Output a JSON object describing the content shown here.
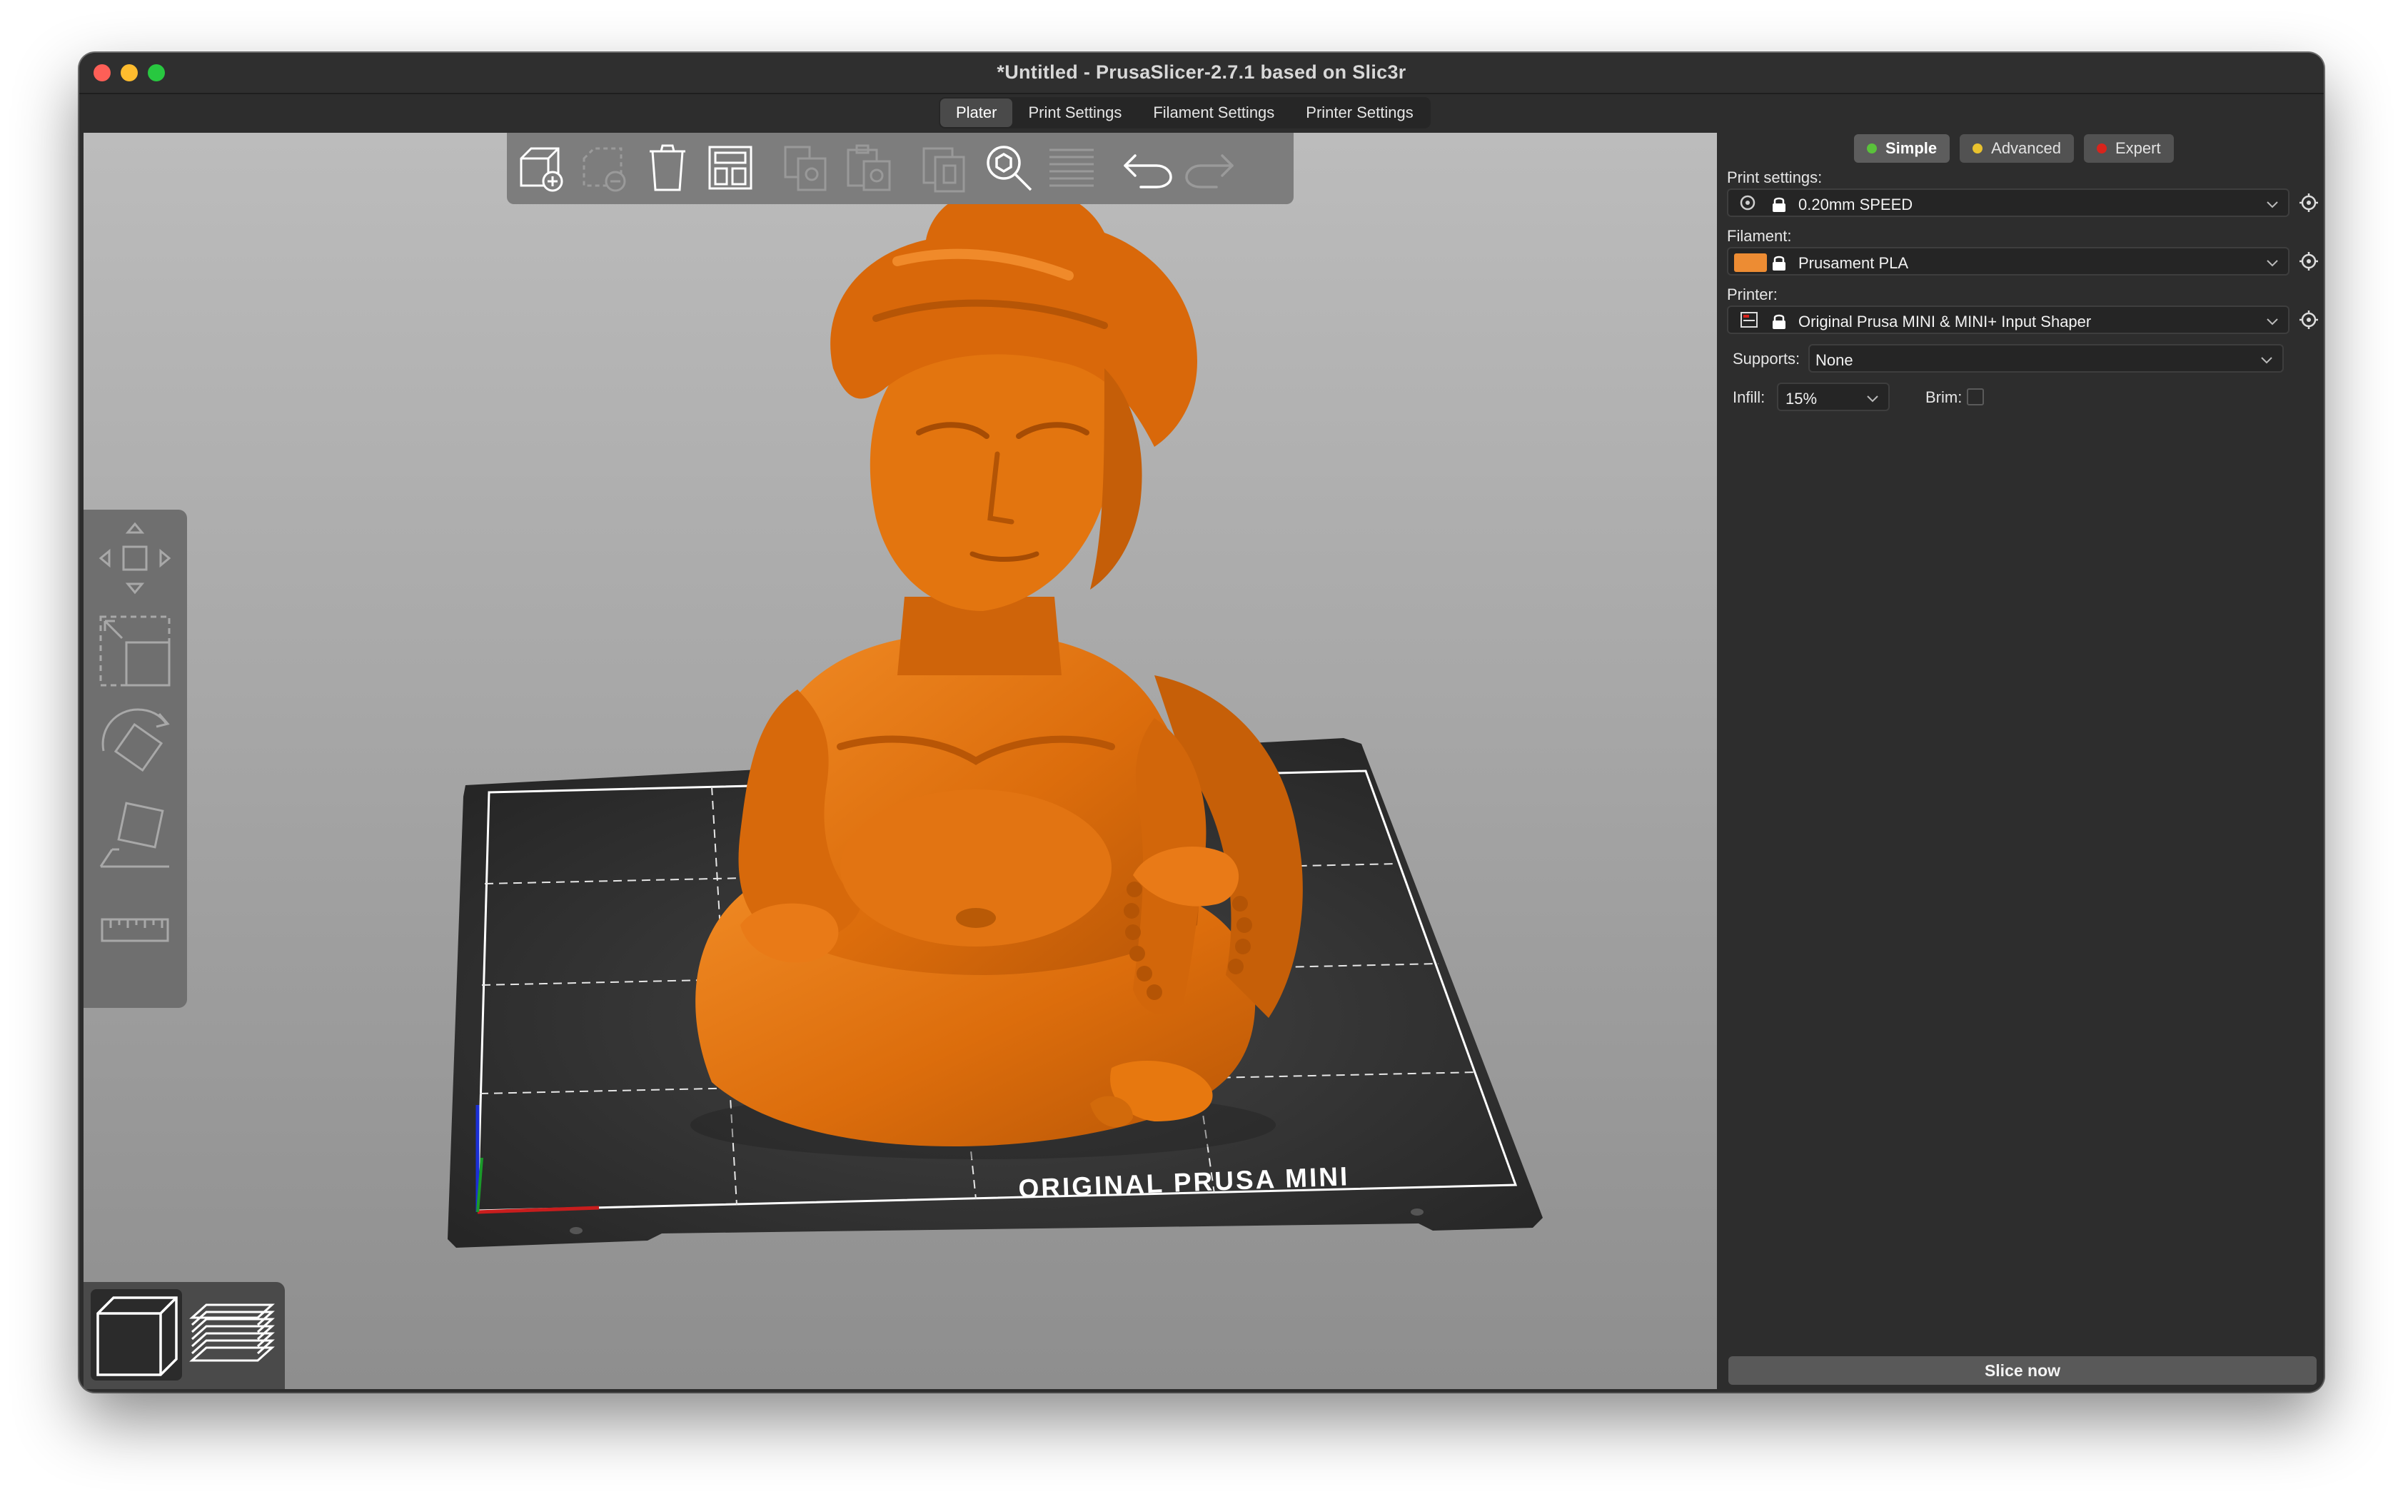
{
  "window": {
    "title": "*Untitled - PrusaSlicer-2.7.1 based on Slic3r"
  },
  "tabs": [
    {
      "label": "Plater",
      "active": true
    },
    {
      "label": "Print Settings",
      "active": false
    },
    {
      "label": "Filament Settings",
      "active": false
    },
    {
      "label": "Printer Settings",
      "active": false
    }
  ],
  "toolbar": {
    "icons": [
      "add-icon",
      "delete-icon",
      "delete-all-icon",
      "arrange-icon",
      "copy-icon",
      "paste-icon",
      "instance-icon",
      "search-icon",
      "layers-editing-icon",
      "undo-icon",
      "redo-icon"
    ]
  },
  "left_tools": {
    "icons": [
      "move-icon",
      "scale-icon",
      "rotate-icon",
      "place-on-face-icon",
      "measure-icon"
    ]
  },
  "view_switch": {
    "icons": [
      "3d-view-icon",
      "preview-icon"
    ],
    "active": "3d-view-icon"
  },
  "bed": {
    "label": "ORIGINAL PRUSA MINI"
  },
  "sidebar": {
    "modes": [
      {
        "label": "Simple",
        "color": "#5ac23b",
        "active": true
      },
      {
        "label": "Advanced",
        "color": "#e9c22e",
        "active": false
      },
      {
        "label": "Expert",
        "color": "#d8241c",
        "active": false
      }
    ],
    "print_settings_label": "Print settings:",
    "print_settings_value": "0.20mm SPEED",
    "filament_label": "Filament:",
    "filament_value": "Prusament PLA",
    "filament_color": "#ed8c33",
    "printer_label": "Printer:",
    "printer_value": "Original Prusa MINI & MINI+ Input Shaper",
    "supports_label": "Supports:",
    "supports_value": "None",
    "infill_label": "Infill:",
    "infill_value": "15%",
    "brim_label": "Brim:",
    "brim_checked": false,
    "slice_button": "Slice now"
  },
  "colors": {
    "model": "#e2710f",
    "bed": "#2b2b2b",
    "viewport_top": "#bcbcbc",
    "viewport_bottom": "#8e8e8e"
  }
}
